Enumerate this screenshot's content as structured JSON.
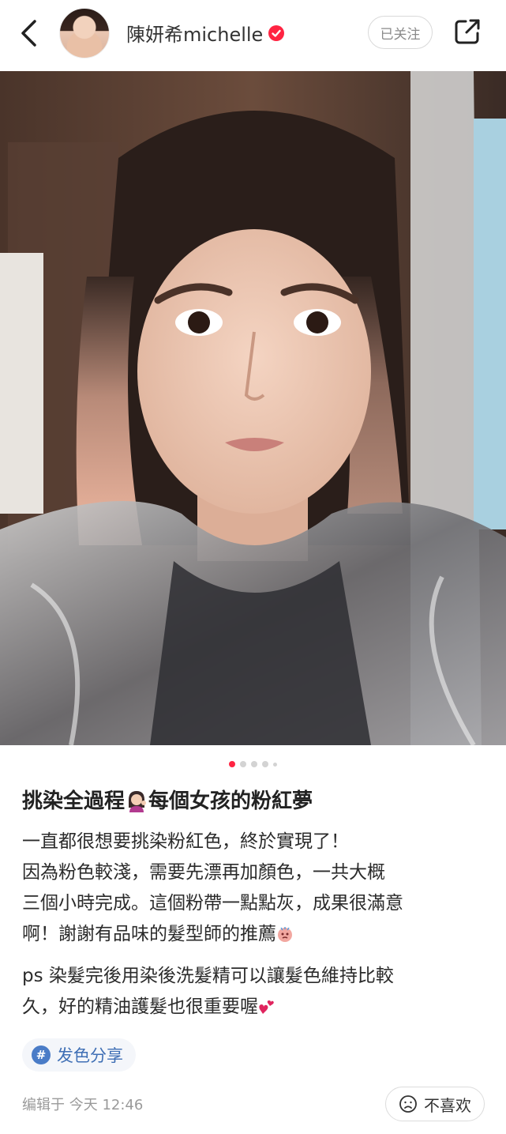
{
  "header": {
    "username": "陳妍希michelle",
    "follow_label": "已关注"
  },
  "photo": {
    "pager": {
      "total": 5,
      "current": 1
    }
  },
  "post": {
    "title_part1": "挑染全過程",
    "title_part2": "每個女孩的粉紅夢",
    "para1_line1": "一直都很想要挑染粉紅色，終於實現了！",
    "para1_line2": "因為粉色較淺，需要先漂再加顏色，一共大概",
    "para1_line3": "三個小時完成。這個粉帶一點點灰，成果很滿意",
    "para1_line4": "啊！謝謝有品味的髮型師的推薦",
    "para2_line1": "ps 染髮完後用染後洗髮精可以讓髮色維持比較",
    "para2_line2": "久，好的精油護髮也很重要喔",
    "tag": "发色分享",
    "edited": "编辑于 今天 12:46",
    "dislike_label": "不喜欢"
  },
  "colors": {
    "accent": "#ff2442",
    "tag_blue": "#3f6fb5",
    "muted": "#9a9a9a"
  },
  "icons": {
    "back": "chevron-left-icon",
    "verified": "verified-badge-icon",
    "share": "share-external-icon",
    "tag": "hashtag-icon",
    "dislike": "sad-face-icon"
  }
}
